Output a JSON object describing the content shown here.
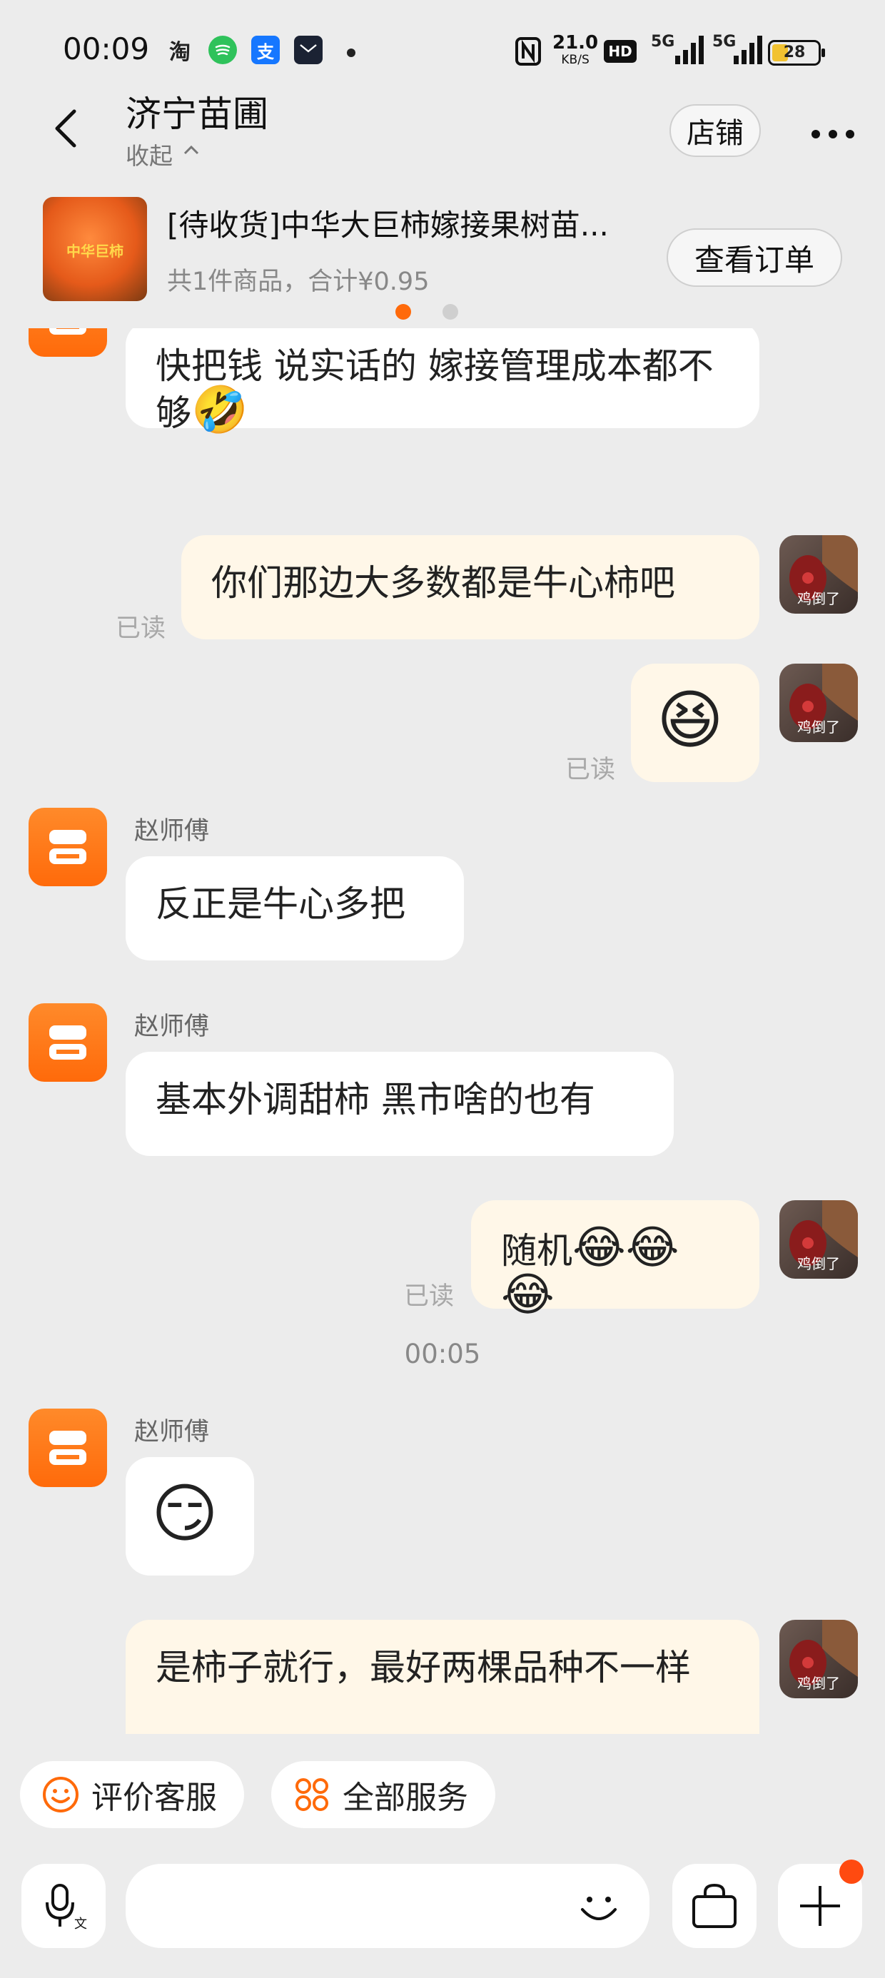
{
  "status_bar": {
    "time": "00:09",
    "apps": [
      "淘",
      "支"
    ],
    "speed_value": "21.0",
    "speed_unit": "KB/S",
    "hd": "HD",
    "net1": "5G",
    "net2": "5G",
    "battery": "28"
  },
  "header": {
    "title": "济宁苗圃",
    "collapse_label": "收起",
    "store_button": "店铺"
  },
  "order": {
    "thumb_text": "中华巨柿",
    "title": "[待收货]中华大巨柿嫁接果树苗...",
    "subtitle": "共1件商品，合计¥0.95",
    "view_button": "查看订单"
  },
  "chat": {
    "my_avatar_label": "鸡倒了",
    "read_label": "已读",
    "messages": [
      {
        "side": "left",
        "text": "快把钱  说实话的  嫁接管理成本都不够"
      },
      {
        "side": "right",
        "text": "你们那边大多数都是牛心柿吧"
      },
      {
        "side": "left",
        "sender": "赵师傅",
        "text": "反正是牛心多把"
      },
      {
        "side": "left",
        "sender": "赵师傅",
        "text": "基本外调甜柿 黑市啥的也有"
      },
      {
        "side": "right",
        "text": "随机"
      },
      {
        "side": "left",
        "sender": "赵师傅"
      },
      {
        "side": "right",
        "text": "是柿子就行，最好两棵品种不一样"
      }
    ],
    "timestamp": "00:05"
  },
  "quick_actions": {
    "rate_service": "评价客服",
    "all_services": "全部服务"
  },
  "input": {
    "placeholder": ""
  },
  "colors": {
    "accent": "#ff6a0a",
    "bubble_right": "#fff7e8",
    "background": "#ececec"
  }
}
